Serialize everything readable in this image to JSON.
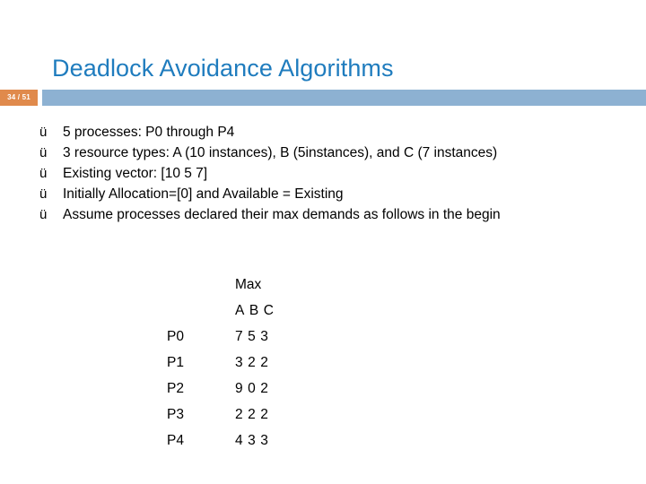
{
  "slide": {
    "title": "Deadlock Avoidance Algorithms",
    "page_badge": "34 / 51",
    "accent_title_color": "#1F7CBE",
    "accent_bar_color": "#8DB1D2",
    "badge_color": "#E08A4C"
  },
  "bullets": {
    "marker": "ü",
    "items": [
      "5 processes: P0 through P4",
      "3 resource types: A (10 instances),  B (5instances), and C (7 instances)",
      "Existing vector: [10 5 7]",
      "Initially Allocation=[0] and Available = Existing",
      "Assume processes declared their max demands as follows in the begin"
    ]
  },
  "matrix": {
    "group_header": "Max",
    "column_headers": [
      "A",
      "B",
      "C"
    ],
    "rows": [
      {
        "label": "P0",
        "values": [
          "7",
          "5",
          "3"
        ]
      },
      {
        "label": "P1",
        "values": [
          "3",
          "2",
          "2"
        ]
      },
      {
        "label": "P2",
        "values": [
          "9",
          "0",
          "2"
        ]
      },
      {
        "label": "P3",
        "values": [
          "2",
          "2",
          "2"
        ]
      },
      {
        "label": "P4",
        "values": [
          "4",
          "3",
          "3"
        ]
      }
    ]
  }
}
